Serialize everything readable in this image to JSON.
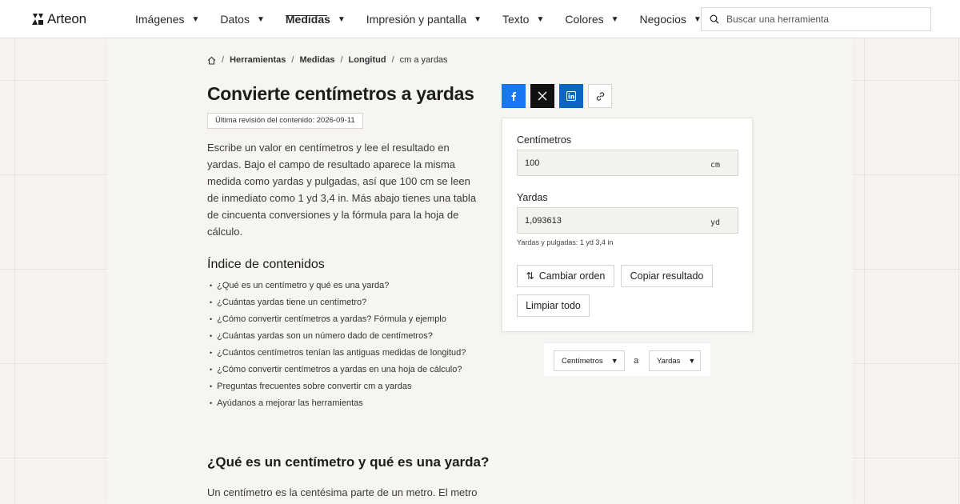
{
  "header": {
    "logo": "Arteon",
    "nav": [
      {
        "label": "Imágenes",
        "active": false
      },
      {
        "label": "Datos",
        "active": false
      },
      {
        "label": "Medidas",
        "active": true
      },
      {
        "label": "Impresión y pantalla",
        "active": false
      },
      {
        "label": "Texto",
        "active": false
      },
      {
        "label": "Colores",
        "active": false
      },
      {
        "label": "Negocios",
        "active": false
      }
    ],
    "search_placeholder": "Buscar una herramienta"
  },
  "breadcrumb": {
    "items": [
      "Herramientas",
      "Medidas",
      "Longitud"
    ],
    "current": "cm a yardas",
    "separator": "/"
  },
  "page": {
    "title": "Convierte centímetros a yardas",
    "revision": "Última revisión del contenido: 2026-09-11",
    "intro": "Escribe un valor en centímetros y lee el resultado en yardas. Bajo el campo de resultado aparece la misma medida como yardas y pulgadas, así que 100 cm se leen de inmediato como 1 yd 3,4 in. Más abajo tienes una tabla de cincuenta conversiones y la fórmula para la hoja de cálculo.",
    "toc_title": "Índice de contenidos",
    "toc": [
      "¿Qué es un centímetro y qué es una yarda?",
      "¿Cuántas yardas tiene un centímetro?",
      "¿Cómo convertir centímetros a yardas? Fórmula y ejemplo",
      "¿Cuántas yardas son un número dado de centímetros?",
      "¿Cuántos centímetros tenían las antiguas medidas de longitud?",
      "¿Cómo convertir centímetros a yardas en una hoja de cálculo?",
      "Preguntas frecuentes sobre convertir cm a yardas",
      "Ayúdanos a mejorar las herramientas"
    ],
    "section_title": "¿Qué es un centímetro y qué es una yarda?",
    "section_text": "Un centímetro es la centésima parte de un metro. El metro"
  },
  "share": {
    "icons": [
      "facebook-icon",
      "x-icon",
      "linkedin-icon",
      "link-icon"
    ],
    "colors": {
      "facebook": "#1877f2",
      "x": "#111111",
      "linkedin": "#0a66c2"
    }
  },
  "calculator": {
    "from_label": "Centímetros",
    "from_value": "100",
    "from_unit": "cm",
    "to_label": "Yardas",
    "to_value": "1,093613",
    "to_unit": "yd",
    "helper": "Yardas y pulgadas: 1 yd 3,4 in",
    "swap_label": "Cambiar orden",
    "copy_label": "Copiar resultado",
    "clear_label": "Limpiar todo"
  },
  "unit_selector": {
    "from": "Centímetros",
    "connector": "a",
    "to": "Yardas"
  }
}
